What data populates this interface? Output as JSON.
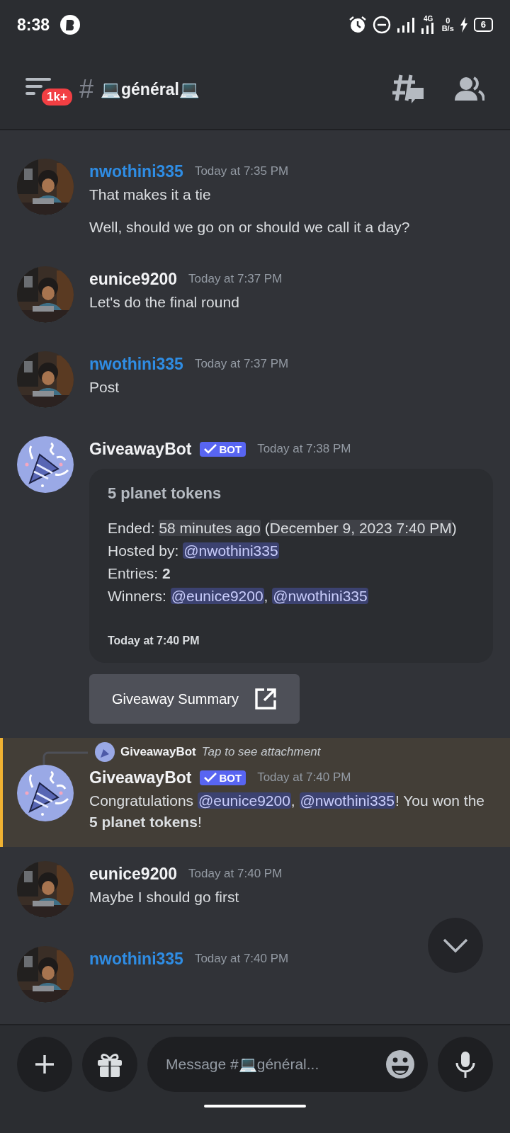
{
  "status_bar": {
    "time": "8:38",
    "network_type": "4G",
    "speed_value": "0",
    "speed_unit": "B/s",
    "battery": "6"
  },
  "header": {
    "unread_badge": "1k+",
    "hash": "#",
    "channel_name": "💻général💻"
  },
  "messages": [
    {
      "kind": "user",
      "author": "nwothini335",
      "color": "#2f8de4",
      "time": "Today at 7:35 PM",
      "highlighted": false,
      "paragraphs": [
        [
          {
            "kind": "plain",
            "text": "That makes it a tie"
          }
        ],
        [
          {
            "kind": "plain",
            "text": "Well, should we go on or should we call it a day?"
          }
        ]
      ]
    },
    {
      "kind": "user",
      "author": "eunice9200",
      "color": "#f2f3f5",
      "time": "Today at 7:37 PM",
      "highlighted": false,
      "paragraphs": [
        [
          {
            "kind": "plain",
            "text": "Let's do the final round"
          }
        ]
      ]
    },
    {
      "kind": "user",
      "author": "nwothini335",
      "color": "#2f8de4",
      "time": "Today at 7:37 PM",
      "highlighted": false,
      "paragraphs": [
        [
          {
            "kind": "plain",
            "text": "Post"
          }
        ]
      ]
    },
    {
      "kind": "bot",
      "author": "GiveawayBot",
      "color": "#f2f3f5",
      "tag": "BOT",
      "time": "Today at 7:38 PM",
      "highlighted": false,
      "embed": {
        "title": "5 planet tokens",
        "lines": [
          [
            {
              "kind": "plain",
              "text": "Ended: "
            },
            {
              "kind": "timestamp",
              "text": "58 minutes ago"
            },
            {
              "kind": "plain",
              "text": " ("
            },
            {
              "kind": "timestamp",
              "text": "December 9, 2023 7:40 PM"
            },
            {
              "kind": "plain",
              "text": ")"
            }
          ],
          [
            {
              "kind": "plain",
              "text": "Hosted by: "
            },
            {
              "kind": "mention",
              "text": "@nwothini335"
            }
          ],
          [
            {
              "kind": "plain",
              "text": "Entries: "
            },
            {
              "kind": "bold",
              "text": "2"
            }
          ],
          [
            {
              "kind": "plain",
              "text": "Winners: "
            },
            {
              "kind": "mention",
              "text": "@eunice9200"
            },
            {
              "kind": "plain",
              "text": ", "
            },
            {
              "kind": "mention",
              "text": "@nwothini335"
            }
          ]
        ],
        "footer": "Today at 7:40 PM"
      },
      "button": "Giveaway Summary"
    },
    {
      "kind": "bot",
      "author": "GiveawayBot",
      "color": "#f2f3f5",
      "tag": "BOT",
      "time": "Today at 7:40 PM",
      "highlighted": true,
      "reply": {
        "author": "GiveawayBot",
        "text": "Tap to see attachment"
      },
      "paragraphs": [
        [
          {
            "kind": "plain",
            "text": "Congratulations "
          },
          {
            "kind": "mention",
            "text": "@eunice9200"
          },
          {
            "kind": "plain",
            "text": ", "
          },
          {
            "kind": "mention",
            "text": "@nwothini335"
          },
          {
            "kind": "plain",
            "text": "! You won the "
          },
          {
            "kind": "bold",
            "text": "5 planet tokens"
          },
          {
            "kind": "plain",
            "text": "!"
          }
        ]
      ]
    },
    {
      "kind": "user",
      "author": "eunice9200",
      "color": "#f2f3f5",
      "time": "Today at 7:40 PM",
      "highlighted": false,
      "paragraphs": [
        [
          {
            "kind": "plain",
            "text": "Maybe I should go first"
          }
        ]
      ]
    },
    {
      "kind": "user",
      "author": "nwothini335",
      "color": "#2f8de4",
      "time": "Today at 7:40 PM",
      "highlighted": false
    }
  ],
  "composer": {
    "placeholder": "Message #💻général..."
  }
}
